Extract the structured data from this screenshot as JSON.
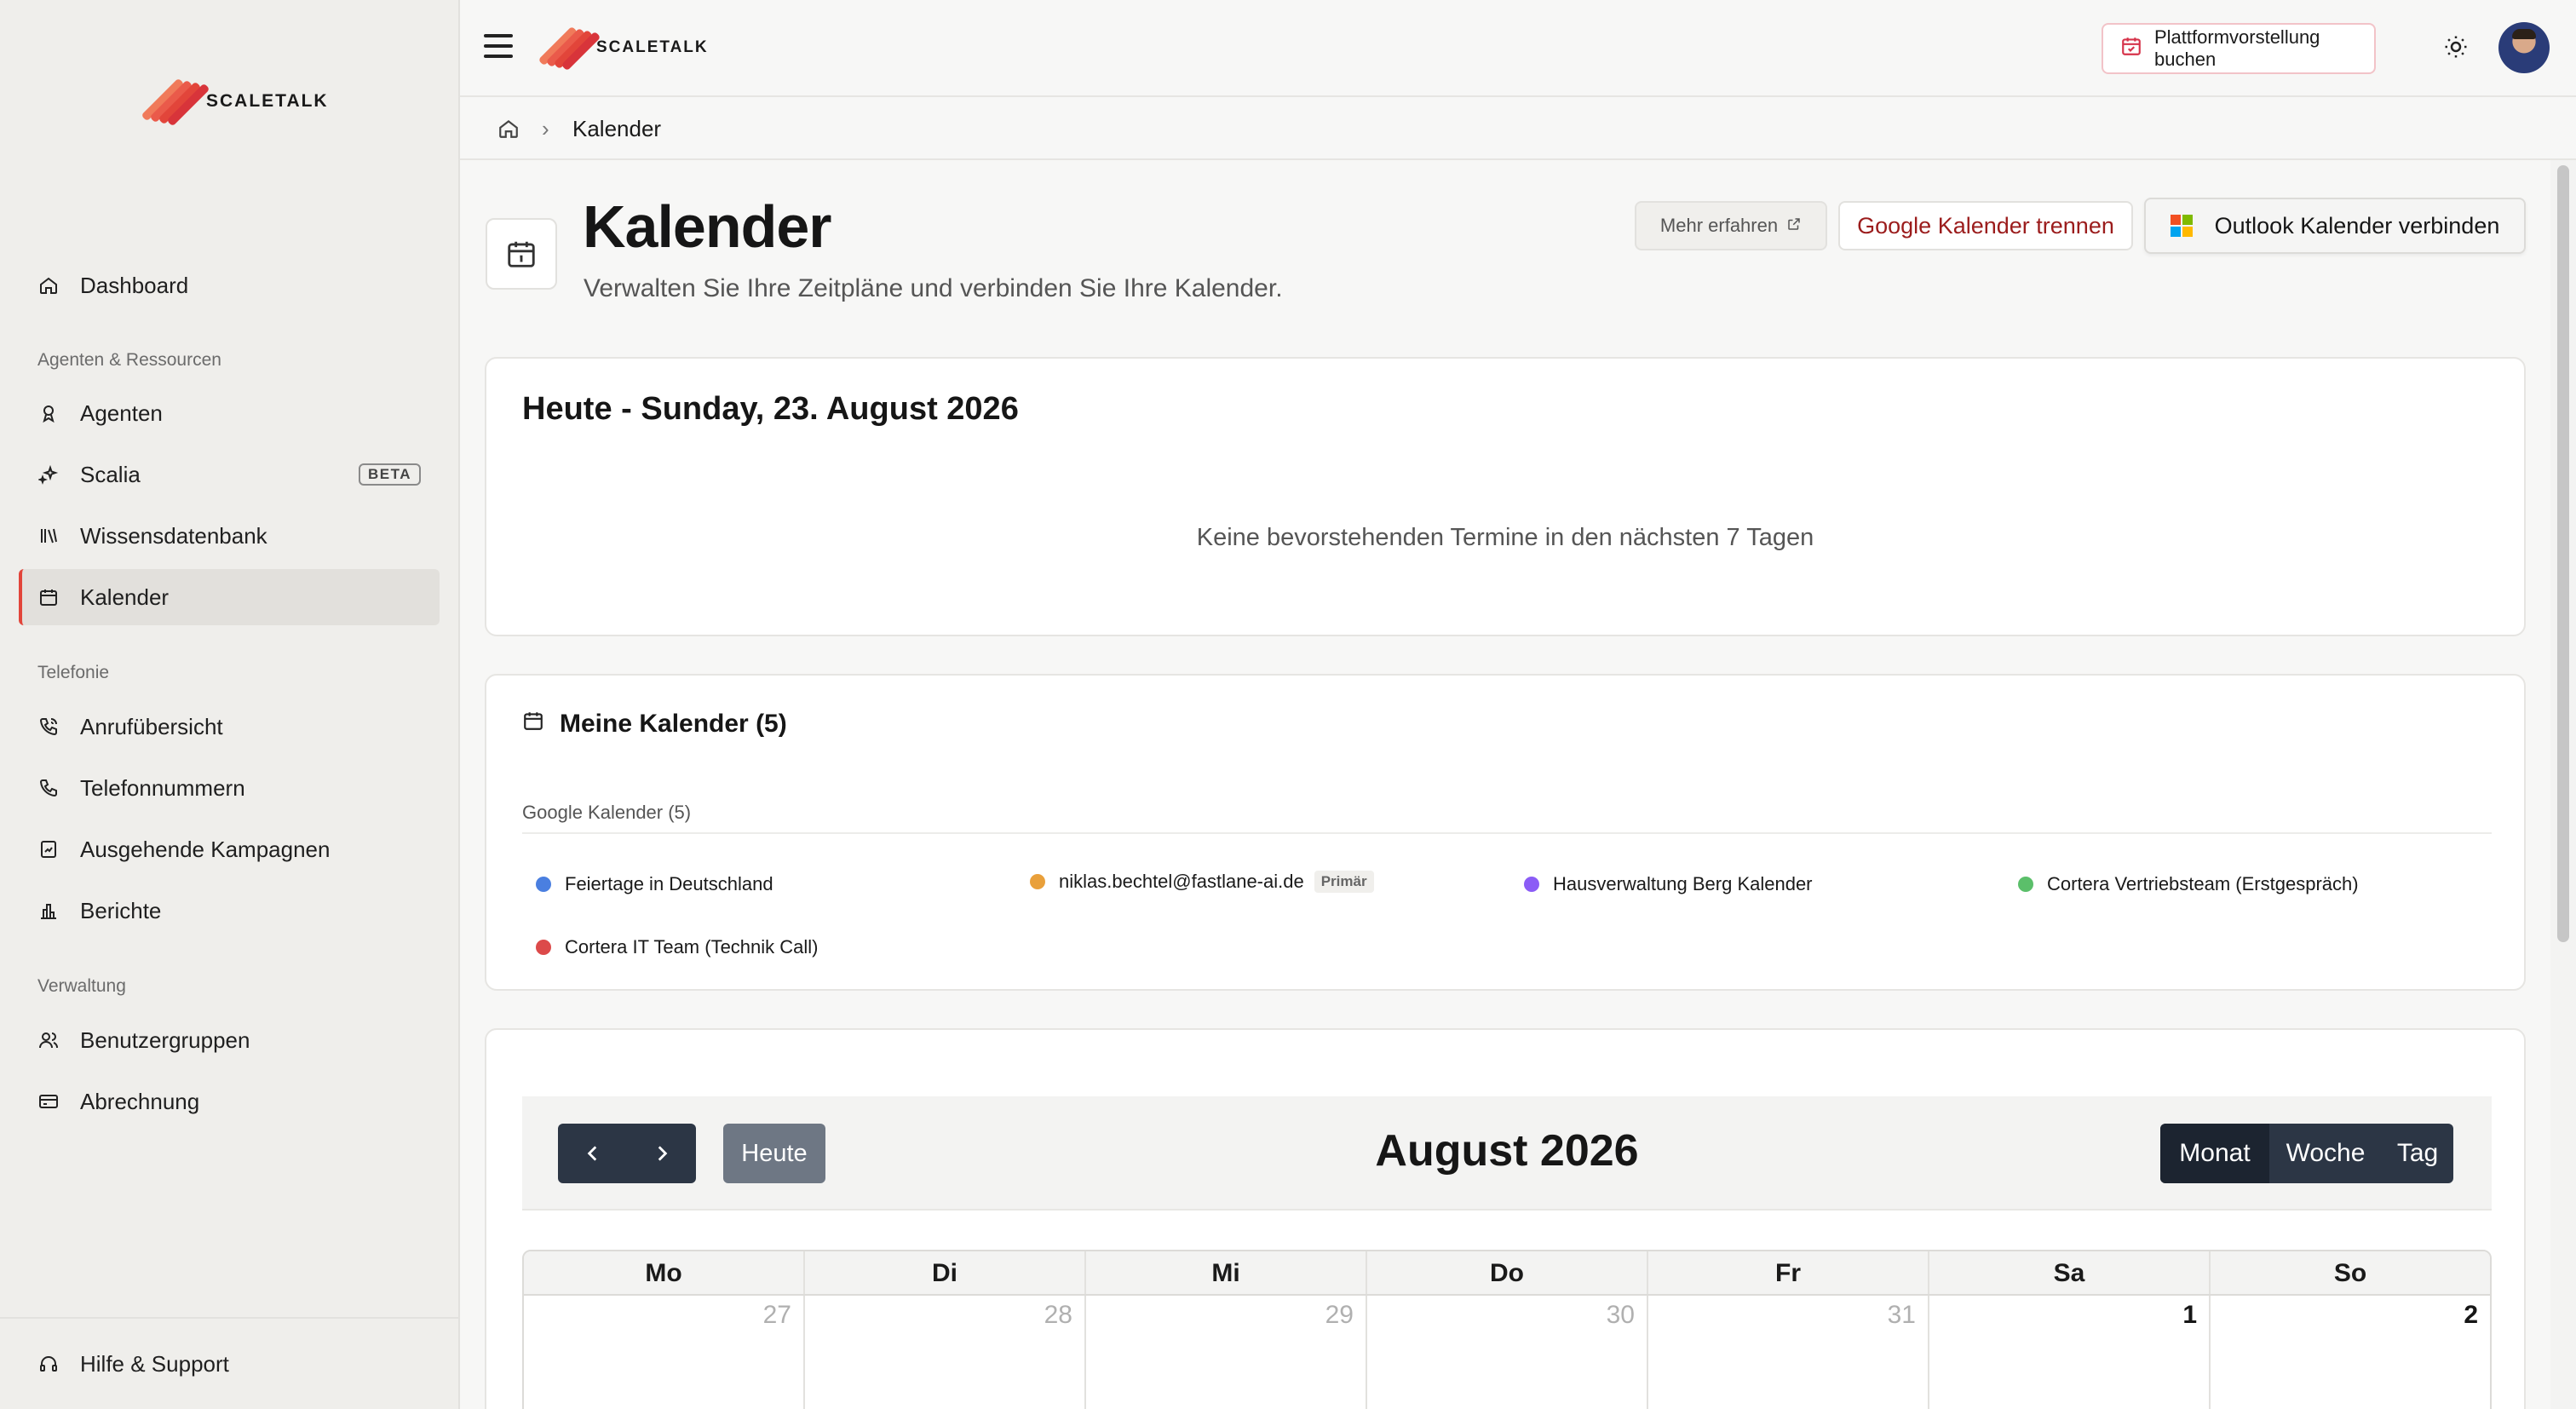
{
  "brand": {
    "name": "SCALETALK",
    "accent": "#e2453a"
  },
  "sidebar": {
    "dashboard": "Dashboard",
    "section_agents": "Agenten & Ressourcen",
    "agents": "Agenten",
    "scalia": "Scalia",
    "scalia_badge": "BETA",
    "knowledge": "Wissensdatenbank",
    "calendar": "Kalender",
    "section_phone": "Telefonie",
    "calls": "Anrufübersicht",
    "numbers": "Telefonnummern",
    "campaigns": "Ausgehende Kampagnen",
    "reports": "Berichte",
    "section_admin": "Verwaltung",
    "groups": "Benutzergruppen",
    "billing": "Abrechnung",
    "help": "Hilfe & Support"
  },
  "topbar": {
    "demo_button": "Plattformvorstellung buchen"
  },
  "breadcrumb": {
    "current": "Kalender"
  },
  "header": {
    "title": "Kalender",
    "subtitle": "Verwalten Sie Ihre Zeitpläne und verbinden Sie Ihre Kalender.",
    "more_label": "Mehr erfahren",
    "google_disconnect": "Google Kalender trennen",
    "outlook_connect": "Outlook Kalender verbinden"
  },
  "today": {
    "title": "Heute - Sunday, 23. August 2026",
    "empty": "Keine bevorstehenden Termine in den nächsten 7 Tagen"
  },
  "calendars": {
    "title": "Meine Kalender (5)",
    "group": "Google Kalender (5)",
    "primary_badge": "Primär",
    "items": [
      {
        "name": "Feiertage in Deutschland",
        "color": "#4a7fe0"
      },
      {
        "name": "niklas.bechtel@fastlane-ai.de",
        "color": "#e9a03b"
      },
      {
        "name": "Hausverwaltung Berg Kalender",
        "color": "#8b5cf6"
      },
      {
        "name": "Cortera Vertriebsteam (Erstgespräch)",
        "color": "#5bbf6a"
      },
      {
        "name": "Cortera IT Team (Technik Call)",
        "color": "#dc4a4a"
      }
    ]
  },
  "month_view": {
    "today_button": "Heute",
    "title": "August 2026",
    "views": [
      "Monat",
      "Woche",
      "Tag"
    ],
    "active_view": "Monat",
    "weekdays": [
      "Mo",
      "Di",
      "Mi",
      "Do",
      "Fr",
      "Sa",
      "So"
    ],
    "first_row": [
      "27",
      "28",
      "29",
      "30",
      "31",
      "1",
      "2"
    ]
  }
}
